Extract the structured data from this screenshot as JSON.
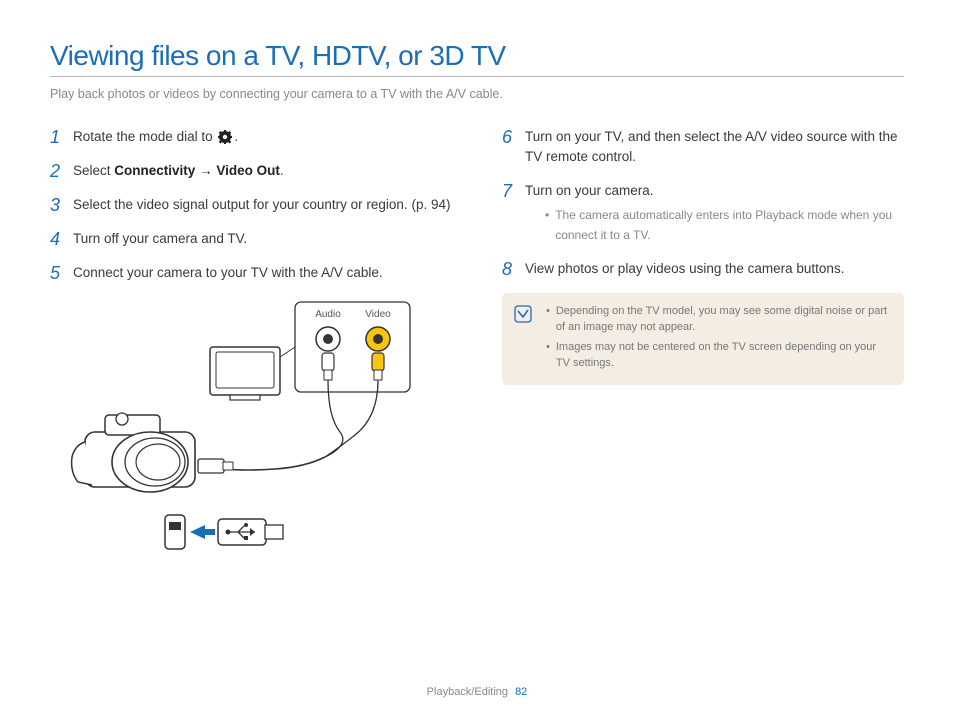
{
  "title": "Viewing files on a TV, HDTV, or 3D TV",
  "subtitle": "Play back photos or videos by connecting your camera to a TV with the A/V cable.",
  "steps": {
    "1": {
      "num": "1",
      "pre": "Rotate the mode dial to ",
      "post": "."
    },
    "2": {
      "num": "2",
      "pre": "Select ",
      "bold1": "Connectivity",
      "arrow": " → ",
      "bold2": "Video Out",
      "post": "."
    },
    "3": {
      "num": "3",
      "text": "Select the video signal output for your country or region. (p. 94)"
    },
    "4": {
      "num": "4",
      "text": "Turn off your camera and TV."
    },
    "5": {
      "num": "5",
      "text": "Connect your camera to your TV with the A/V cable."
    },
    "6": {
      "num": "6",
      "text": "Turn on your TV, and then select the A/V video source with the TV remote control."
    },
    "7": {
      "num": "7",
      "text": "Turn on your camera.",
      "sub": "The camera automatically enters into Playback mode when you connect it to a TV."
    },
    "8": {
      "num": "8",
      "text": "View photos or play videos using the camera buttons."
    }
  },
  "diagram": {
    "audio": "Audio",
    "video": "Video"
  },
  "notes": {
    "n1": "Depending on the TV model, you may see some digital noise or part of an image may not appear.",
    "n2": "Images may not be centered on the TV screen depending on your TV settings."
  },
  "footer": {
    "section": "Playback/Editing",
    "page": "82"
  }
}
